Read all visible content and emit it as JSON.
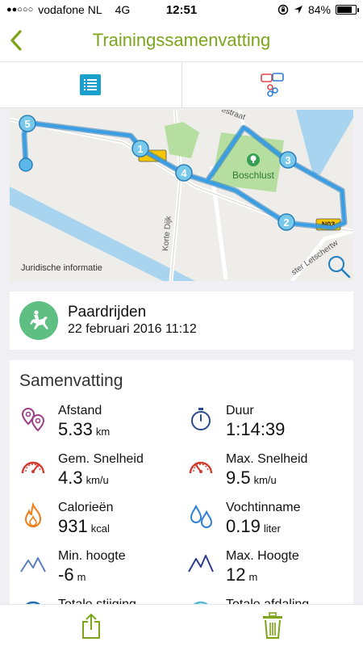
{
  "status_bar": {
    "carrier": "vodafone NL",
    "network": "4G",
    "time": "12:51",
    "battery": "84%",
    "battery_level": 0.84
  },
  "nav": {
    "title": "Trainingssamenvatting"
  },
  "map": {
    "legal_label": "Juridische informatie",
    "park_label": "Boschlust",
    "road_label_1": "Korte Dijk",
    "road_label_2": "ster Letschertw",
    "road_label_3": "estraat",
    "road_badge": "N03",
    "markers": [
      "1",
      "2",
      "3",
      "4",
      "5"
    ]
  },
  "activity": {
    "name": "Paardrijden",
    "date": "22 februari 2016 11:12"
  },
  "summary": {
    "title": "Samenvatting",
    "stats": [
      {
        "label": "Afstand",
        "value": "5.33",
        "unit": "km",
        "icon": "location-pins-icon"
      },
      {
        "label": "Duur",
        "value": "1:14:39",
        "unit": "",
        "icon": "stopwatch-icon"
      },
      {
        "label": "Gem. Snelheid",
        "value": "4.3",
        "unit": "km/u",
        "icon": "speedometer-icon"
      },
      {
        "label": "Max. Snelheid",
        "value": "9.5",
        "unit": "km/u",
        "icon": "speedometer-icon"
      },
      {
        "label": "Calorieën",
        "value": "931",
        "unit": "kcal",
        "icon": "flame-icon"
      },
      {
        "label": "Vochtinname",
        "value": "0.19",
        "unit": "liter",
        "icon": "water-drops-icon"
      },
      {
        "label": "Min. hoogte",
        "value": "-6",
        "unit": "m",
        "icon": "mountains-icon"
      },
      {
        "label": "Max. Hoogte",
        "value": "12",
        "unit": "m",
        "icon": "mountains-icon"
      },
      {
        "label": "Totale stijging",
        "value": "",
        "unit": "",
        "icon": "ascent-icon"
      },
      {
        "label": "Totale afdaling",
        "value": "",
        "unit": "",
        "icon": "descent-icon"
      }
    ]
  },
  "colors": {
    "accent": "#7ca51a",
    "route": "#3a9ee4",
    "tab_active": "#1aa0cc",
    "activity": "#5fbf83"
  }
}
